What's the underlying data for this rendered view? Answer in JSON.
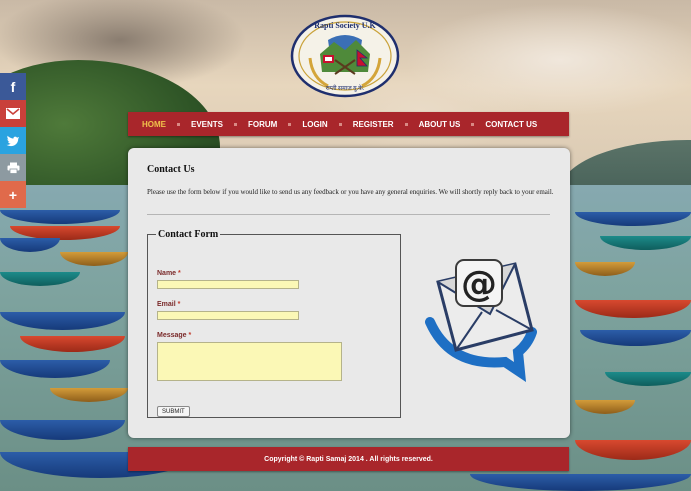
{
  "logo": {
    "text": "Rapti Society U.K."
  },
  "share": {
    "icons": [
      "facebook-icon",
      "gmail-icon",
      "twitter-icon",
      "print-icon",
      "plus-icon"
    ],
    "colors": {
      "facebook": "#3b5998",
      "gmail": "#c9403a",
      "twitter": "#2aa3e0",
      "print": "#8d9aa1",
      "plus": "#e06a4b"
    }
  },
  "nav": {
    "items": [
      "HOME",
      "EVENTS",
      "FORUM",
      "LOGIN",
      "REGISTER",
      "ABOUT US",
      "CONTACT US"
    ],
    "active": "HOME",
    "colors": {
      "bar": "#a9262b",
      "active": "#f0c24b",
      "text": "#ffffff"
    }
  },
  "contact": {
    "title": "Contact Us",
    "intro": "Please use the form below if you would like to send us any feedback or you have any general enquiries. We will shortly reply back to your email.",
    "form": {
      "legend": "Contact Form",
      "name_label": "Name",
      "email_label": "Email",
      "message_label": "Message",
      "required_mark": "*",
      "submit_label": "SUBMIT"
    },
    "icon": "email-envelope-icon"
  },
  "footer": {
    "text": "Copyright © Rapti Samaj 2014 . All rights reserved."
  }
}
